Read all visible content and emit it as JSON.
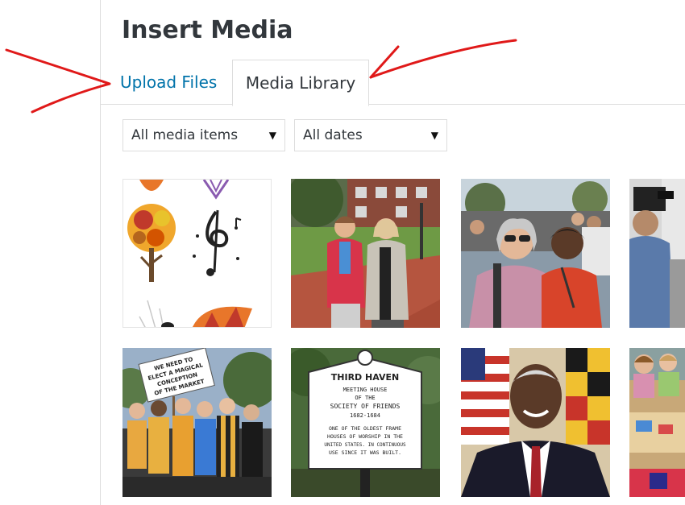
{
  "modal": {
    "title": "Insert Media",
    "tabs": [
      {
        "label": "Upload Files",
        "active": false
      },
      {
        "label": "Media Library",
        "active": true
      }
    ],
    "filters": {
      "media_type": {
        "selected": "All media items"
      },
      "date": {
        "selected": "All dates"
      }
    }
  },
  "media_items": [
    {
      "description": "music and tree illustrations"
    },
    {
      "description": "two women on campus lawn"
    },
    {
      "description": "two women at outdoor event"
    },
    {
      "description": "man with video camera"
    },
    {
      "description": "group holding protest sign",
      "sign_text": "WE NEED TO ELECT A MAGICAL CONCEPTION OF THE MARKET"
    },
    {
      "description": "historic marker sign",
      "sign_text": [
        "THIRD HAVEN",
        "MEETING HOUSE",
        "OF THE",
        "SOCIETY OF FRIENDS",
        "1682-1684",
        "ONE OF THE OLDEST FRAME",
        "HOUSES OF WORSHIP IN THE",
        "UNITED STATES. IN CONTINUOUS",
        "USE SINCE IT WAS BUILT."
      ]
    },
    {
      "description": "portrait in front of flags"
    },
    {
      "description": "children in classroom"
    }
  ],
  "colors": {
    "annotation_arrow": "#e01919",
    "link": "#0073aa",
    "border": "#dddddd"
  }
}
